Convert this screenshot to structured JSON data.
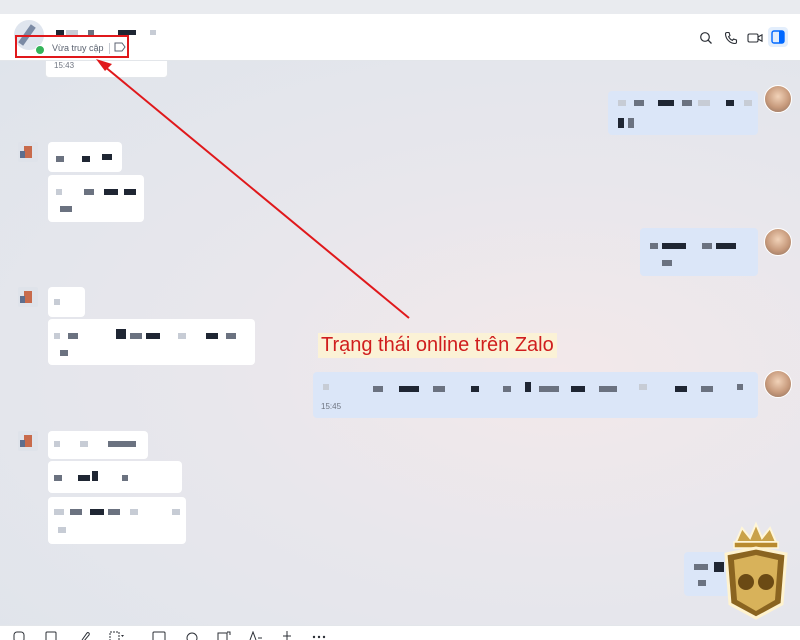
{
  "header": {
    "contact_status": "Vừa truy cập",
    "icons": [
      "search-icon",
      "phone-icon",
      "video-icon",
      "side-panel-icon"
    ]
  },
  "messages": {
    "first_time": "15:43",
    "outgoing_time": "15:45"
  },
  "annotation": {
    "text": "Trạng thái online trên Zalo"
  },
  "toolbar": {
    "icons": [
      "sticker-icon",
      "image-icon",
      "attach-icon",
      "screenshot-icon",
      "card-icon",
      "reminder-icon",
      "task-icon",
      "text-format-icon",
      "priority-icon",
      "more-icon"
    ]
  },
  "colors": {
    "accent": "#0068ff",
    "annotation_red": "#e0181b",
    "online_green": "#34b45a",
    "outgoing_bubble": "#dbe6f8"
  }
}
